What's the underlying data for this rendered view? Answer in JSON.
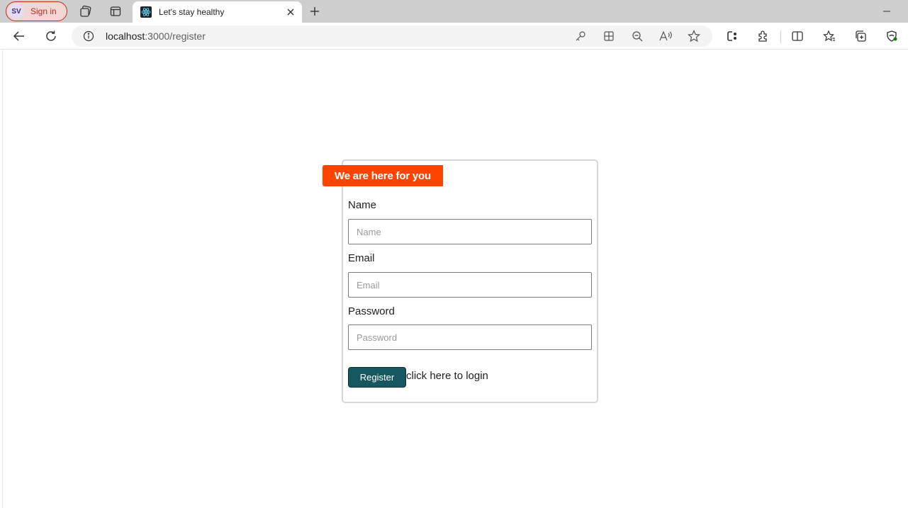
{
  "browser": {
    "profile": {
      "initials": "SV",
      "signin_label": "Sign in"
    },
    "tab": {
      "title": "Let's stay healthy"
    },
    "address": {
      "host": "localhost",
      "path": ":3000/register"
    }
  },
  "page": {
    "banner": "We are here for you",
    "form": {
      "name": {
        "label": "Name",
        "placeholder": "Name",
        "value": ""
      },
      "email": {
        "label": "Email",
        "placeholder": "Email",
        "value": ""
      },
      "password": {
        "label": "Password",
        "placeholder": "Password",
        "value": ""
      },
      "register_label": "Register",
      "login_link": "click here to login"
    }
  },
  "colors": {
    "banner": "#ff4400",
    "register_button": "#17575f",
    "signin_accent": "#c42b1c"
  },
  "icons": [
    "workspaces-icon",
    "tab-actions-icon",
    "react-favicon-icon",
    "close-icon",
    "plus-icon",
    "minimize-icon",
    "back-icon",
    "refresh-icon",
    "info-icon",
    "password-key-icon",
    "app-available-icon",
    "zoom-out-icon",
    "read-aloud-icon",
    "favorite-star-icon",
    "copilot-icon",
    "extensions-icon",
    "split-screen-icon",
    "favorites-icon",
    "collections-icon",
    "browser-essentials-icon"
  ]
}
